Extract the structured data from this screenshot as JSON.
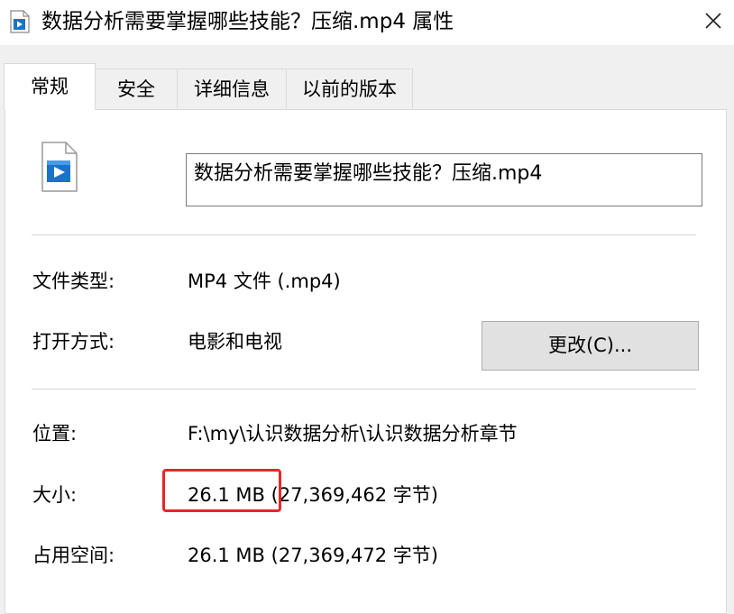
{
  "window": {
    "title": "数据分析需要掌握哪些技能？压缩.mp4 属性",
    "title_icon": "video-file-icon",
    "close_icon": "close-icon"
  },
  "tabs": [
    {
      "label": "常规",
      "active": true
    },
    {
      "label": "安全",
      "active": false
    },
    {
      "label": "详细信息",
      "active": false
    },
    {
      "label": "以前的版本",
      "active": false
    }
  ],
  "general": {
    "file_icon": "video-file-icon",
    "file_name": "数据分析需要掌握哪些技能？压缩.mp4",
    "file_type_label": "文件类型:",
    "file_type_value": "MP4 文件 (.mp4)",
    "open_with_label": "打开方式:",
    "open_with_value": "电影和电视",
    "change_button": "更改(C)...",
    "location_label": "位置:",
    "location_value": "F:\\my\\认识数据分析\\认识数据分析章节",
    "size_label": "大小:",
    "size_value": "26.1 MB (27,369,462 字节)",
    "size_on_disk_label": "占用空间:",
    "size_on_disk_value": "26.1 MB (27,369,472 字节)"
  },
  "colors": {
    "highlight": "#e8262a",
    "icon_blue": "#1a73c9"
  }
}
